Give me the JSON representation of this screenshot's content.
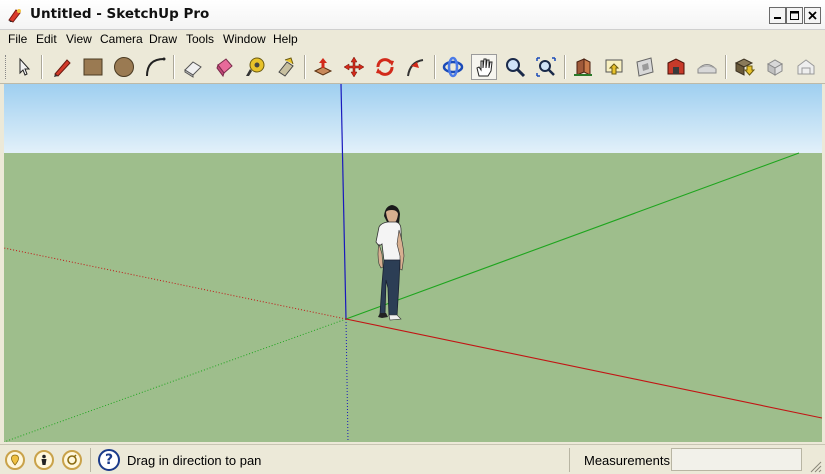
{
  "window": {
    "title": "Untitled - SketchUp Pro"
  },
  "menu": [
    "File",
    "Edit",
    "View",
    "Camera",
    "Draw",
    "Tools",
    "Window",
    "Help"
  ],
  "toolbar": {
    "tools": [
      "select-arrow-icon",
      "pencil-line-icon",
      "rectangle-icon",
      "circle-icon",
      "arc-icon",
      "eraser-icon",
      "paint-bucket-icon",
      "tape-measure-icon",
      "push-pull-icon",
      "move-icon",
      "rotate-icon",
      "follow-me-icon",
      "orbit-icon",
      "pan-hand-icon",
      "zoom-icon",
      "zoom-extents-icon",
      "component-icon",
      "import-icon",
      "section-plane-icon",
      "warehouse-icon",
      "sandbox-icon",
      "share-model-icon",
      "get-models-icon",
      "extension-icon"
    ],
    "active_tool": "pan-hand-icon"
  },
  "viewport": {
    "sky_color": "#c4e1f5",
    "ground_color": "#9ebe8c",
    "axis_colors": {
      "red": "#c21414",
      "green": "#1ea51e",
      "blue": "#1919bd"
    }
  },
  "status": {
    "hint": "Drag in direction to pan",
    "measurements_label": "Measurements",
    "measurements_value": ""
  }
}
